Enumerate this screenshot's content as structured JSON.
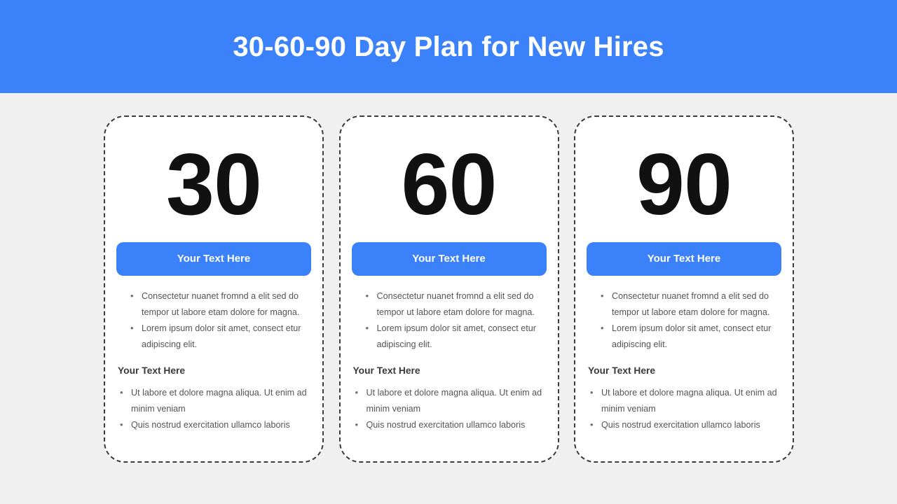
{
  "header": {
    "title": "30-60-90 Day Plan for New Hires",
    "background_color": "#3b82fa",
    "text_color": "#ffffff"
  },
  "theme": {
    "accent_color": "#3b82fa",
    "page_background": "#f0f0f0",
    "card_background": "#ffffff",
    "card_border_color": "#3c3c3c",
    "number_color": "#111111",
    "body_text_color": "#555555",
    "heading_text_color": "#3a3a3a"
  },
  "cards": [
    {
      "number": "30",
      "button_label": "Your Text Here",
      "bullets_primary": [
        "Consectetur nuanet fromnd a elit sed do tempor ut labore etam dolore for magna.",
        "Lorem ipsum dolor sit amet, consect etur adipiscing elit."
      ],
      "section_heading": "Your Text Here",
      "bullets_secondary": [
        "Ut labore et dolore magna aliqua. Ut enim ad minim veniam",
        "Quis nostrud exercitation ullamco laboris"
      ]
    },
    {
      "number": "60",
      "button_label": "Your Text Here",
      "bullets_primary": [
        "Consectetur nuanet fromnd a elit sed do tempor ut labore etam dolore for magna.",
        "Lorem ipsum dolor sit amet, consect etur adipiscing elit."
      ],
      "section_heading": "Your Text Here",
      "bullets_secondary": [
        "Ut labore et dolore magna aliqua. Ut enim ad minim veniam",
        "Quis nostrud exercitation ullamco laboris"
      ]
    },
    {
      "number": "90",
      "button_label": "Your Text Here",
      "bullets_primary": [
        "Consectetur nuanet fromnd a elit sed do tempor ut labore etam dolore for magna.",
        "Lorem ipsum dolor sit amet, consect etur adipiscing elit."
      ],
      "section_heading": "Your Text Here",
      "bullets_secondary": [
        "Ut labore et dolore magna aliqua. Ut enim ad minim veniam",
        "Quis nostrud exercitation ullamco laboris"
      ]
    }
  ]
}
